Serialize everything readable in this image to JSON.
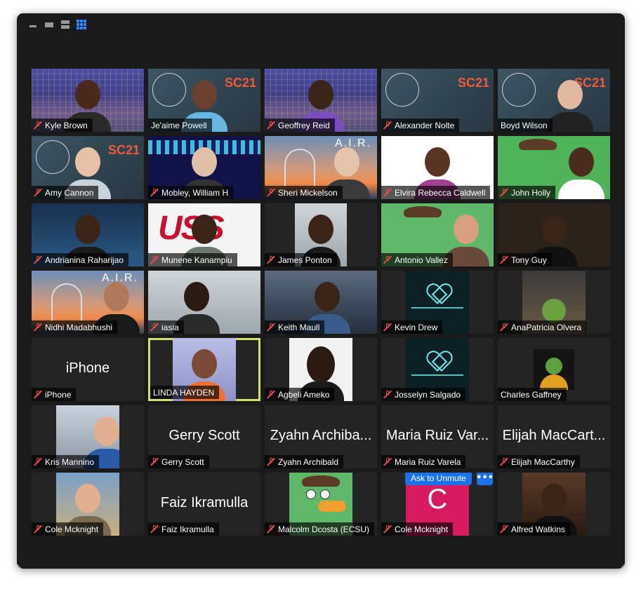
{
  "colors": {
    "window_bg": "#1a1a1a",
    "tile_bg": "#242424",
    "accent_blue": "#1a73e8",
    "muted_red": "#e84a4a",
    "active_speaker": "#d3e36a"
  },
  "view_controls": [
    {
      "icon": "minimize-icon"
    },
    {
      "icon": "thumbnail-view-icon"
    },
    {
      "icon": "speaker-view-icon"
    },
    {
      "icon": "gallery-view-icon",
      "active": true
    }
  ],
  "participants": [
    {
      "name": "Kyle Brown",
      "muted": true
    },
    {
      "name": "Je'aime Powell",
      "muted": false
    },
    {
      "name": "Geoffrey Reid",
      "muted": true
    },
    {
      "name": "Alexander Nolte",
      "muted": true
    },
    {
      "name": "Boyd Wilson",
      "muted": false
    },
    {
      "name": "Amy Cannon",
      "muted": true
    },
    {
      "name": "Mobley, William H",
      "muted": true
    },
    {
      "name": "Sheri Mickelson",
      "muted": true
    },
    {
      "name": "Elvira Rebecca Caldwell",
      "muted": true
    },
    {
      "name": "John Holly",
      "muted": true
    },
    {
      "name": "Andrianina Raharijao",
      "muted": true
    },
    {
      "name": "Munene Kanampiu",
      "muted": true
    },
    {
      "name": "James Ponton",
      "muted": true
    },
    {
      "name": "Antonio Vallez",
      "muted": true
    },
    {
      "name": "Tony Guy",
      "muted": true
    },
    {
      "name": "Nidhi Madabhushi",
      "muted": true
    },
    {
      "name": "iasia",
      "muted": true
    },
    {
      "name": "Keith Maull",
      "muted": true
    },
    {
      "name": "Kevin Drew",
      "muted": true
    },
    {
      "name": "AnaPatricia Olvera",
      "muted": true
    },
    {
      "name": "iPhone",
      "muted": true,
      "display_name": "iPhone"
    },
    {
      "name": "LINDA HAYDEN",
      "muted": false,
      "active_speaker": true
    },
    {
      "name": "Agbeli Ameko",
      "muted": true
    },
    {
      "name": "Josselyn Salgado",
      "muted": true
    },
    {
      "name": "Charles Gaffney",
      "muted": false
    },
    {
      "name": "Kris Mannino",
      "muted": true
    },
    {
      "name": "Gerry Scott",
      "muted": true,
      "display_name": "Gerry Scott"
    },
    {
      "name": "Zyahn Archibald",
      "muted": true,
      "display_name": "Zyahn Archiba..."
    },
    {
      "name": "Maria Ruiz Varela",
      "muted": true,
      "display_name": "Maria Ruiz Var..."
    },
    {
      "name": "Elijah MacCarthy",
      "muted": true,
      "display_name": "Elijah MacCart..."
    },
    {
      "name": "Cole Mcknight",
      "muted": true
    },
    {
      "name": "Faiz Ikramulla",
      "muted": true,
      "display_name": "Faiz Ikramulla"
    },
    {
      "name": "Malcolm Dcosta (ECSU)",
      "muted": true
    },
    {
      "name": "Cole Mcknight",
      "muted": true,
      "avatar_letter": "C",
      "hover": true
    },
    {
      "name": "Alfred Watkins",
      "muted": true
    }
  ],
  "hover_controls": {
    "ask_unmute_label": "Ask to Unmute",
    "more_label": "•••"
  },
  "heading_backgrounds": {
    "hackathon_text": "SC21",
    "air_text": "A.I.R."
  }
}
